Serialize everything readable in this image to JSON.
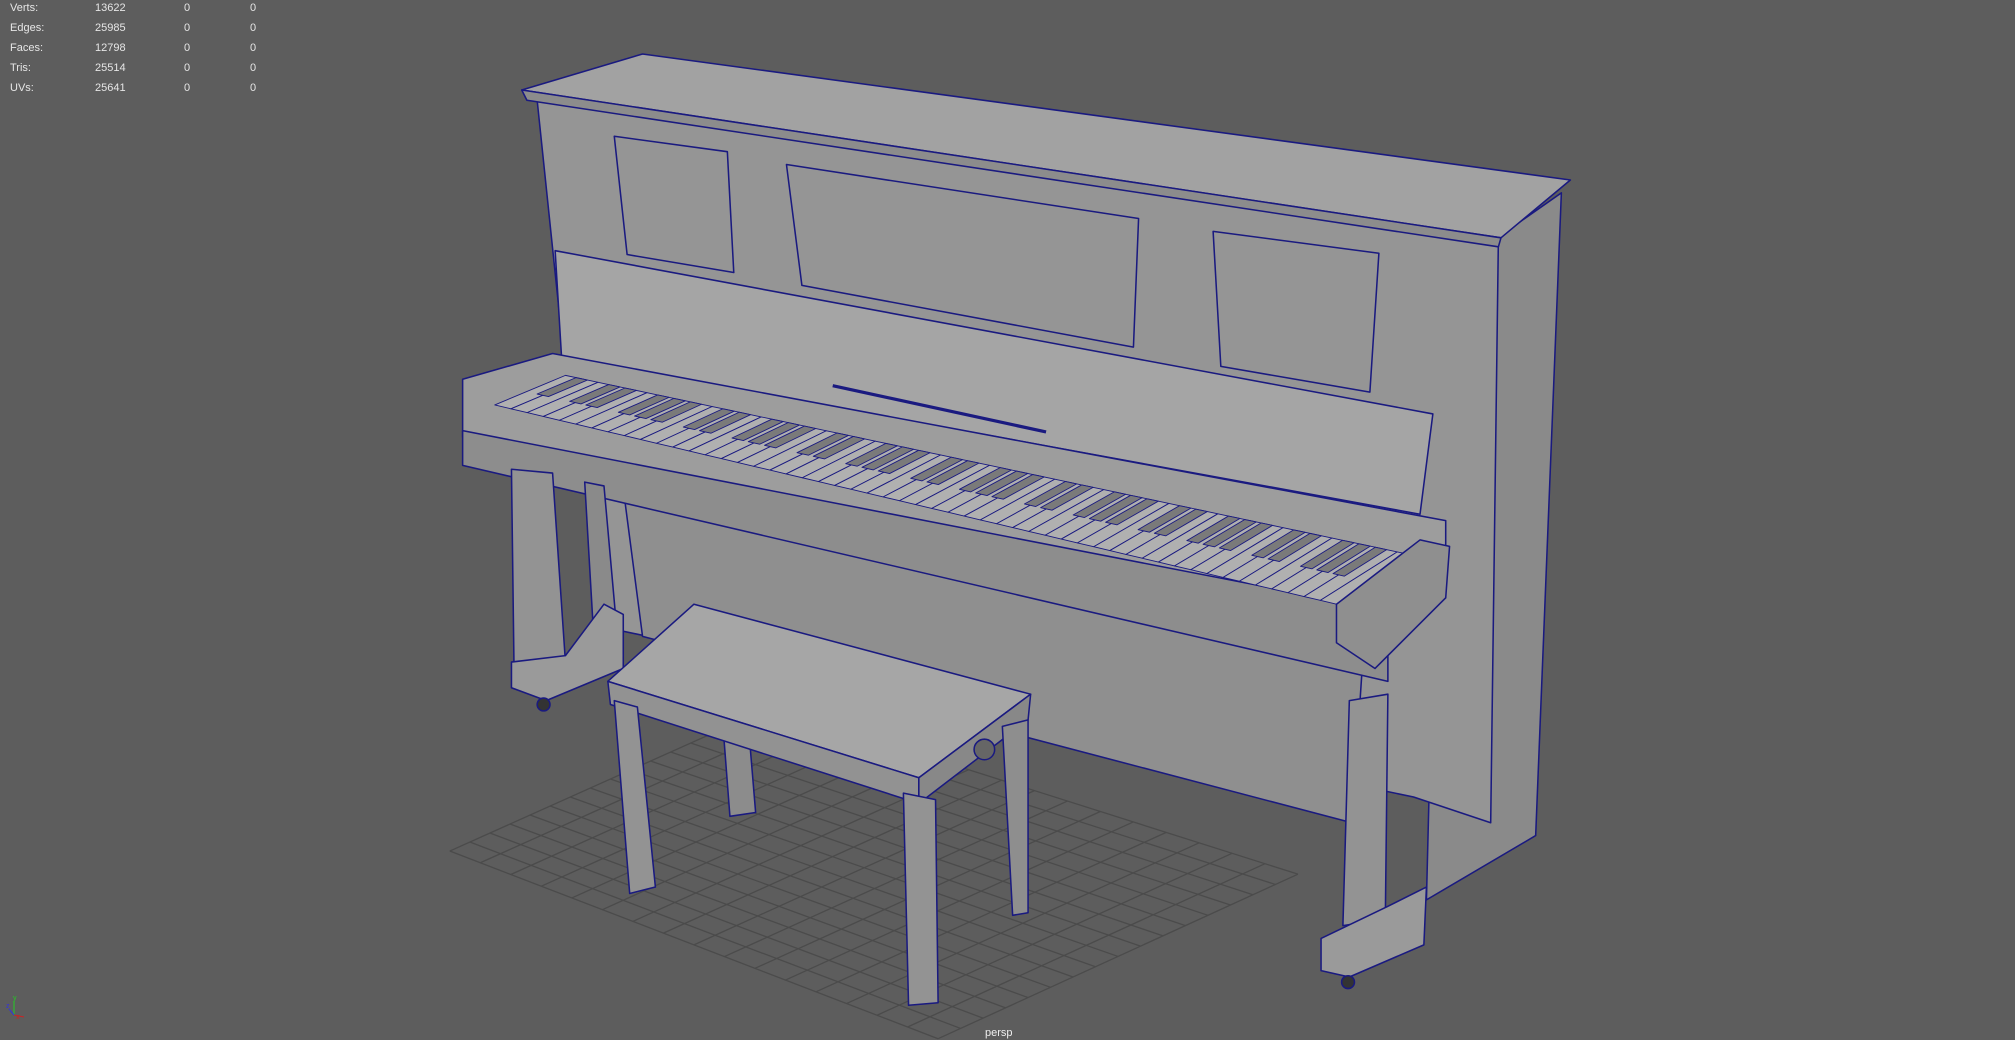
{
  "hud": {
    "rows": [
      {
        "label": "Verts:",
        "total": "13622",
        "selected": "0",
        "extra": "0"
      },
      {
        "label": "Edges:",
        "total": "25985",
        "selected": "0",
        "extra": "0"
      },
      {
        "label": "Faces:",
        "total": "12798",
        "selected": "0",
        "extra": "0"
      },
      {
        "label": "Tris:",
        "total": "25514",
        "selected": "0",
        "extra": "0"
      },
      {
        "label": "UVs:",
        "total": "25641",
        "selected": "0",
        "extra": "0"
      }
    ]
  },
  "camera": {
    "label": "persp"
  },
  "axis": {
    "x": "x",
    "y": "y",
    "z": "z"
  },
  "colors": {
    "background": "#5d5d5d",
    "mesh": "#9a9a9a",
    "wire": "#1a1a80",
    "grid": "#4a4a4a"
  }
}
